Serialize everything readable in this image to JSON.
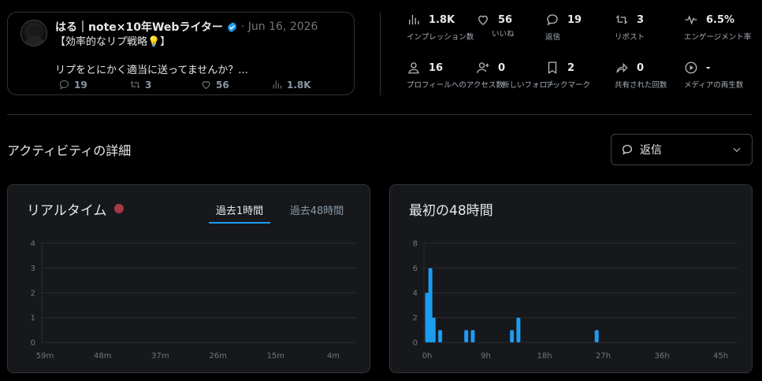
{
  "tweet": {
    "author": "はる｜note×10年Webライター",
    "date": "· Jun 16, 2026",
    "text_line1": "【効率的なリプ戦略💡】",
    "text_line2": "リプをとにかく適当に送ってませんか？...",
    "replies": "19",
    "reposts": "3",
    "likes": "56",
    "views": "1.8K"
  },
  "metrics": {
    "impressions": {
      "value": "1.8K",
      "label": "インプレッション数",
      "icon": "bar-chart-icon"
    },
    "likes": {
      "value": "56",
      "label": "いいね",
      "icon": "heart-icon"
    },
    "replies": {
      "value": "19",
      "label": "返信",
      "icon": "reply-icon"
    },
    "reposts": {
      "value": "3",
      "label": "リポスト",
      "icon": "repost-icon"
    },
    "engagement": {
      "value": "6.5%",
      "label": "エンゲージメント率",
      "icon": "pulse-icon"
    },
    "profile_visits": {
      "value": "16",
      "label": "プロフィールへのアクセス数",
      "icon": "person-icon"
    },
    "new_follows": {
      "value": "0",
      "label": "新しいフォロー",
      "icon": "add-person-icon"
    },
    "bookmarks": {
      "value": "2",
      "label": "ブックマーク",
      "icon": "bookmark-icon"
    },
    "shares": {
      "value": "0",
      "label": "共有された回数",
      "icon": "share-icon"
    },
    "media_views": {
      "value": "-",
      "label": "メディアの再生数",
      "icon": "play-icon"
    }
  },
  "activity": {
    "title": "アクティビティの詳細",
    "dropdown_label": "返信"
  },
  "realtime": {
    "title": "リアルタイム",
    "tab_1h": "過去1時間",
    "tab_48h": "過去48時間",
    "active_tab": "過去1時間"
  },
  "first48": {
    "title": "最初の48時間"
  },
  "colors": {
    "accent": "#1d9bf0",
    "bar": "#1d9bf0",
    "live_dot": "#a83846",
    "verified": "#1d9bf0"
  },
  "chart_data": [
    {
      "type": "bar",
      "name": "realtime",
      "x_ticks": [
        "59m",
        "48m",
        "37m",
        "26m",
        "15m",
        "4m"
      ],
      "y_ticks": [
        "0",
        "1",
        "2",
        "3",
        "4"
      ],
      "ylim": [
        0,
        4
      ],
      "values": [],
      "grid": true
    },
    {
      "type": "bar",
      "name": "first_48_hours",
      "x_ticks": [
        "0h",
        "9h",
        "18h",
        "27h",
        "36h",
        "45h"
      ],
      "y_ticks": [
        "0",
        "2",
        "4",
        "6",
        "8"
      ],
      "ylim": [
        0,
        8
      ],
      "x_hours": [
        0,
        0.5,
        1,
        2,
        3,
        6,
        7,
        13,
        14,
        26
      ],
      "values": [
        4,
        6,
        2,
        1,
        0,
        1,
        1,
        1,
        2,
        1
      ],
      "grid": true
    }
  ]
}
